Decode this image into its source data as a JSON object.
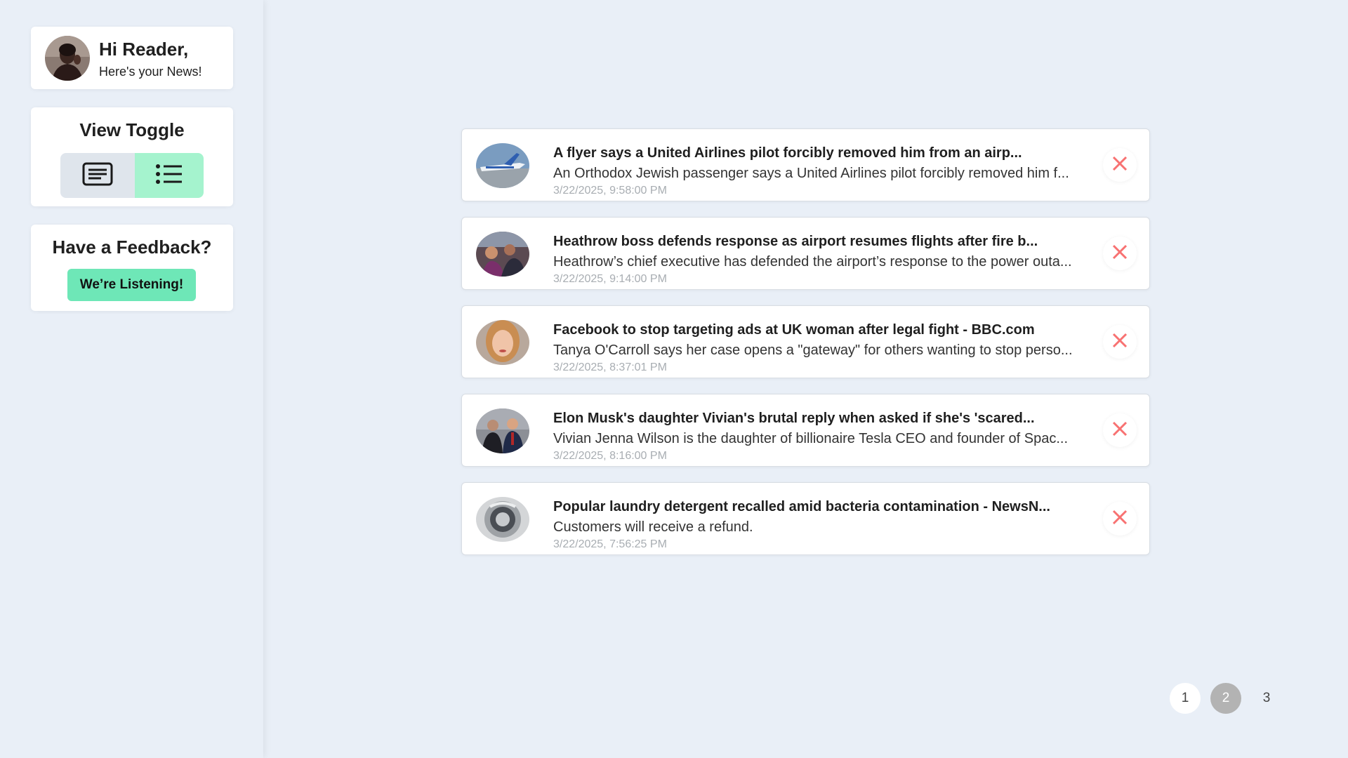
{
  "greeting": {
    "title": "Hi Reader,",
    "subtitle": "Here's your News!",
    "avatar_icon": "user-avatar"
  },
  "view_toggle": {
    "title": "View Toggle",
    "options": [
      {
        "name": "card-view",
        "icon": "article-icon",
        "active": false
      },
      {
        "name": "list-view",
        "icon": "list-icon",
        "active": true
      }
    ]
  },
  "feedback": {
    "title": "Have a Feedback?",
    "button_label": "We’re Listening!"
  },
  "news": [
    {
      "title": "A flyer says a United Airlines pilot forcibly removed him from an airp...",
      "description": "An Orthodox Jewish passenger says a United Airlines pilot forcibly removed him f...",
      "time": "3/22/2025, 9:58:00 PM"
    },
    {
      "title": "Heathrow boss defends response as airport resumes flights after fire b...",
      "description": "Heathrow’s chief executive has defended the airport’s response to the power outa...",
      "time": "3/22/2025, 9:14:00 PM"
    },
    {
      "title": "Facebook to stop targeting ads at UK woman after legal fight - BBC.com",
      "description": "Tanya O'Carroll says her case opens a \"gateway\" for others wanting to stop perso...",
      "time": "3/22/2025, 8:37:01 PM"
    },
    {
      "title": "Elon Musk's daughter Vivian's brutal reply when asked if she's 'scared...",
      "description": "Vivian Jenna Wilson is the daughter of billionaire Tesla CEO and founder of Spac...",
      "time": "3/22/2025, 8:16:00 PM"
    },
    {
      "title": "Popular laundry detergent recalled amid bacteria contamination - NewsN...",
      "description": "Customers will receive a refund.",
      "time": "3/22/2025, 7:56:25 PM"
    }
  ],
  "pagination": {
    "pages": [
      "1",
      "2",
      "3"
    ],
    "current": "2"
  },
  "colors": {
    "background": "#e9eff7",
    "accent": "#6ee7b7",
    "toggle_active": "#a5f3ce",
    "close": "#f87171",
    "page_active": "#b3b3b3"
  }
}
